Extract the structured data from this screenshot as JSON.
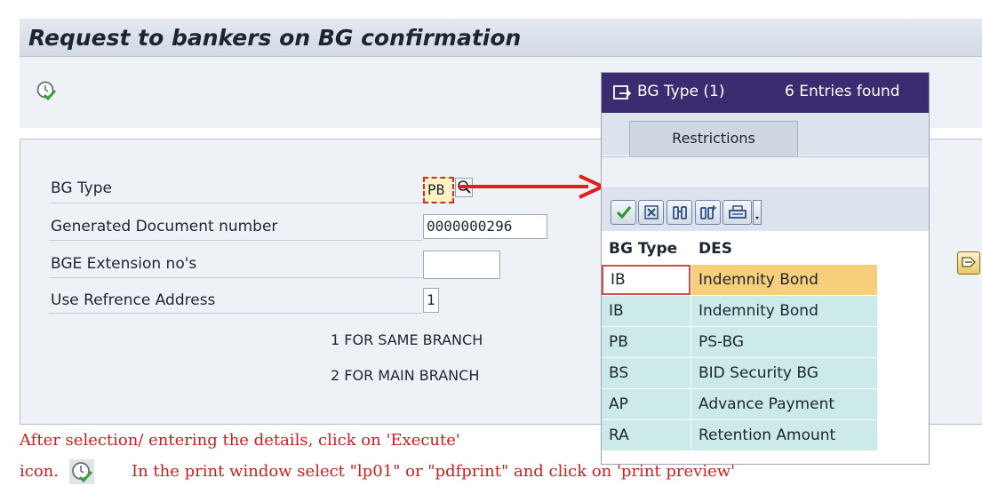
{
  "window": {
    "title": "Request to bankers on BG confirmation"
  },
  "toolbar": {
    "execute_icon": "execute-clock-check-icon"
  },
  "form": {
    "bg_type": {
      "label": "BG Type",
      "value": "PB"
    },
    "doc_number": {
      "label": "Generated Document number",
      "value": "0000000296"
    },
    "extension": {
      "label": "BGE Extension no's",
      "value": ""
    },
    "ref_address": {
      "label": "Use Refrence Address",
      "value": "1"
    },
    "note1": "1 FOR SAME BRANCH",
    "note2": "2 FOR MAIN BRANCH"
  },
  "popup": {
    "title": "BG Type (1)",
    "entries_found": "6 Entries found",
    "tab": "Restrictions",
    "columns": [
      "BG Type",
      "DES"
    ],
    "rows": [
      {
        "code": "IB",
        "desc": "Indemnity Bond"
      },
      {
        "code": "IB",
        "desc": "Indemnity Bond"
      },
      {
        "code": "PB",
        "desc": "PS-BG"
      },
      {
        "code": "BS",
        "desc": "BID Security BG"
      },
      {
        "code": "AP",
        "desc": "Advance Payment"
      },
      {
        "code": "RA",
        "desc": "Retention Amount"
      }
    ],
    "buttons": [
      "check-icon",
      "cancel-x-icon",
      "binoculars-icon",
      "binoculars-plus-icon",
      "printer-icon",
      "dropdown-arrow-icon"
    ]
  },
  "instructions": {
    "line1": "After selection/ entering the details, click on 'Execute'",
    "line2_pre": "icon.",
    "line2_post": "In the print window select \"lp01\" or \"pdfprint\" and click on 'print preview'"
  },
  "colors": {
    "annotation_red": "#e01f1f",
    "popup_title_bg": "#3b2b70",
    "selected_row": "#f7cf7a"
  }
}
